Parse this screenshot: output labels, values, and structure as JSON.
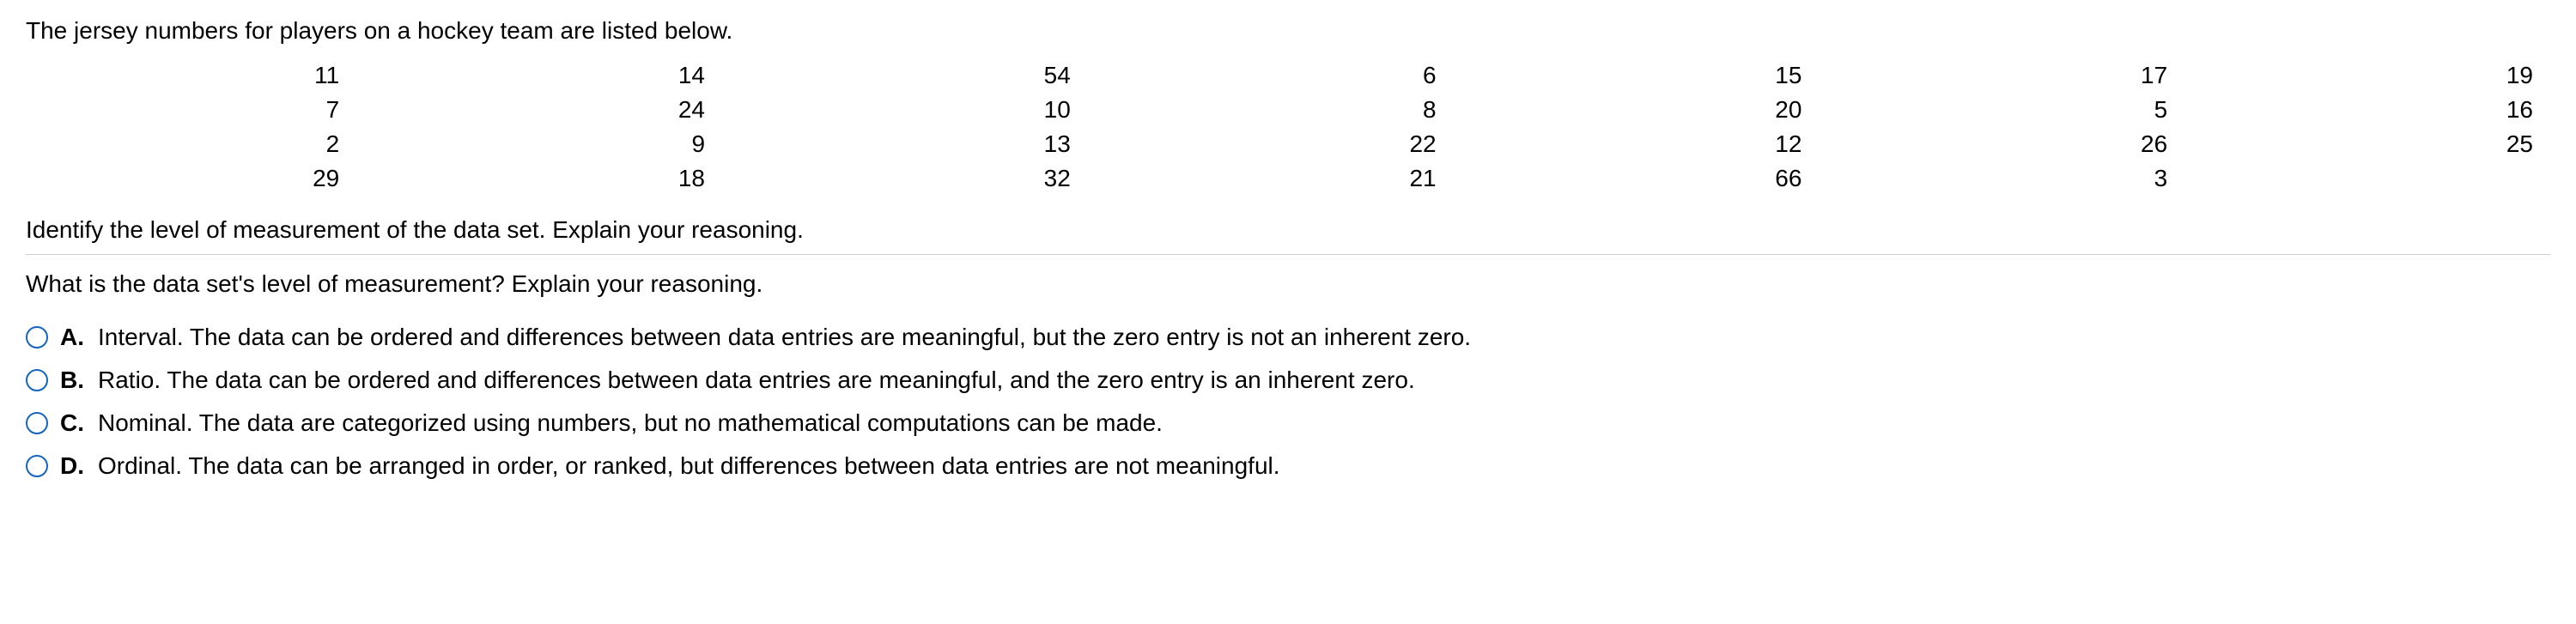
{
  "intro": "The jersey numbers for players on a hockey team are listed below.",
  "table": {
    "rows": [
      [
        "11",
        "14",
        "54",
        "6",
        "15",
        "17",
        "19"
      ],
      [
        "7",
        "24",
        "10",
        "8",
        "20",
        "5",
        "16"
      ],
      [
        "2",
        "9",
        "13",
        "22",
        "12",
        "26",
        "25"
      ],
      [
        "29",
        "18",
        "32",
        "21",
        "66",
        "3",
        ""
      ]
    ]
  },
  "instruction": "Identify the level of measurement of the data set. Explain your reasoning.",
  "question": "What is the data set's level of measurement? Explain your reasoning.",
  "choices": [
    {
      "letter": "A.",
      "text": "Interval. The data can be ordered and differences between data entries are meaningful, but the zero entry is not an inherent zero."
    },
    {
      "letter": "B.",
      "text": "Ratio. The data can be ordered and differences between data entries are meaningful, and the zero entry is an inherent zero."
    },
    {
      "letter": "C.",
      "text": "Nominal. The data are categorized using numbers, but no mathematical computations can be made."
    },
    {
      "letter": "D.",
      "text": "Ordinal. The data can be arranged in order, or ranked, but differences between data entries are not meaningful."
    }
  ]
}
